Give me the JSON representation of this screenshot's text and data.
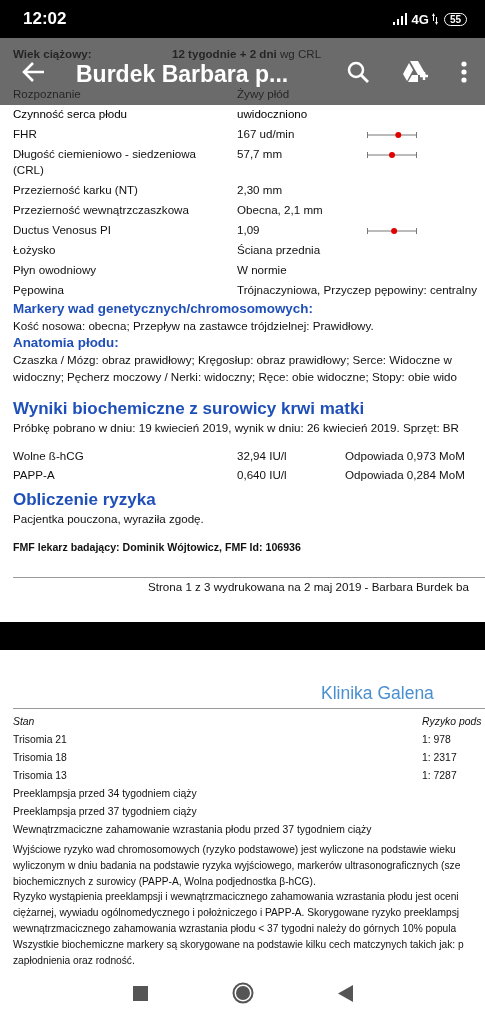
{
  "status_bar": {
    "time": "12:02",
    "network": "4G",
    "battery": "55"
  },
  "toolbar": {
    "title": "Burdek Barbara p..."
  },
  "page_1": {
    "gestational_age": {
      "label": "Wiek ciążowy:",
      "value": "**12 tygodnie + 2 dni** wg CRL"
    },
    "findings": [
      {
        "kind": "plain",
        "label": "Rozpoznanie",
        "value": "Żywy płód"
      },
      {
        "kind": "plain",
        "label": "Czynność serca płodu",
        "value": "uwidoczniono"
      },
      {
        "kind": "range",
        "label": "FHR",
        "value": "167 ud/min",
        "level": 0.65
      },
      {
        "kind": "range",
        "label": "Długość ciemieniowo - siedzeniowa (CRL)",
        "value": "57,7 mm",
        "level": 0.5
      },
      {
        "kind": "plain",
        "label": "Przezierność karku (NT)",
        "value": "2,30 mm"
      },
      {
        "kind": "plain",
        "label": "Przezierność wewnątrzczaszkowa",
        "value": "Obecna, 2,1 mm"
      },
      {
        "kind": "range",
        "label": "Ductus Venosus PI",
        "value": "1,09",
        "level": 0.55
      },
      {
        "kind": "plain",
        "label": "Łożysko",
        "value": "Ściana przednia"
      },
      {
        "kind": "plain",
        "label": "Płyn owodniowy",
        "value": "W normie"
      },
      {
        "kind": "plain",
        "label": "Pępowina",
        "value": "Trójnaczyniowa, Przyczep pępowiny: centralny"
      }
    ],
    "markers": {
      "heading": "Markery wad genetycznych/chromosomowych:",
      "text": "Kość nosowa: obecna;  Przepływ na zastawce trójdzielnej: Prawidłowy."
    },
    "anatomy": {
      "heading": "Anatomia płodu:",
      "lines": [
        "Czaszka / Mózg: obraz prawidłowy;  Kręgosłup: obraz prawidłowy;  Serce: Widoczne w",
        "widoczny;  Pęcherz moczowy / Nerki: widoczny;  Ręce: obie widoczne;  Stopy: obie wido"
      ]
    },
    "biochemistry": {
      "heading": "Wyniki biochemiczne z surowicy krwi matki",
      "note": "Próbkę pobrano w dniu: 19 kwiecień 2019, wynik w dniu: 26 kwiecień 2019.   Sprzęt: BR",
      "rows": [
        {
          "name": "Wolne ß-hCG",
          "value": "32,94 IU/l",
          "mom": "Odpowiada 0,973 MoM"
        },
        {
          "name": "PAPP-A",
          "value": "0,640 IU/l",
          "mom": "Odpowiada 0,284 MoM"
        }
      ]
    },
    "risk": {
      "heading": "Obliczenie ryzyka",
      "text": "Pacjentka pouczona, wyraziła zgodę."
    },
    "examiner": "FMF lekarz badający: Dominik Wójtowicz, FMF Id: 106936",
    "footer": "Strona 1 z 3 wydrukowana na 2 maj 2019 -  Barbara Burdek ba"
  },
  "page_2": {
    "clinic": "Klinika Galena",
    "table": {
      "columns": [
        "Stan",
        "Ryzyko pods"
      ],
      "rows": [
        {
          "condition": "Trisomia 21",
          "risk": "1: 978"
        },
        {
          "condition": "Trisomia 18",
          "risk": "1: 2317"
        },
        {
          "condition": "Trisomia 13",
          "risk": "1: 7287"
        },
        {
          "condition": "Preeklampsja przed 34 tygodniem ciąży"
        },
        {
          "condition": "Preeklampsja przed 37 tygodniem ciąży"
        },
        {
          "condition": "Wewnątrzmaciczne zahamowanie wzrastania płodu przed 37 tygodniem ciąży"
        }
      ]
    },
    "paragraph_lines": [
      "Wyjściowe ryzyko wad chromosomowych (ryzyko podstawowe) jest wyliczone na podstawie wieku",
      "wyliczonym w dniu badania na podstawie ryzyka wyjściowego, markerów ultrasonograficznych (sze",
      "biochemicznych z surowicy (PAPP-A, Wolna podjednostka β-hCG).",
      "Ryzyko wystąpienia preeklampsji i wewnątrzmacicznego zahamowania wzrastania płodu jest oceni",
      "ciężarnej, wywiadu ogólnomedycznego i położniczego i PAPP-A. Skorygowane ryzyko preeklampsj",
      "wewnątrzmacicznego zahamowania wzrastania płodu < 37 tygodni należy do górnych 10% popula",
      "Wszystkie biochemiczne markery są skorygowane na podstawie kilku cech matczynych takich jak: p",
      "zapłodnienia oraz rodność."
    ]
  }
}
